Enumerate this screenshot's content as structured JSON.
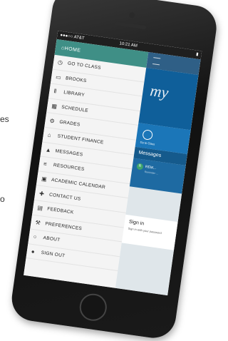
{
  "background_text": [
    "es",
    "o"
  ],
  "status_bar": {
    "carrier": "●●●○○ AT&T",
    "time": "10:21 AM"
  },
  "menu": {
    "home_label": "HOME",
    "items": [
      {
        "icon": "clock-icon",
        "glyph": "◷",
        "label": "GO TO CLASS"
      },
      {
        "icon": "book-icon",
        "glyph": "▭",
        "label": "BROOKS"
      },
      {
        "icon": "library-icon",
        "glyph": "Ⅱ",
        "label": "LIBRARY"
      },
      {
        "icon": "calendar-icon",
        "glyph": "▦",
        "label": "SCHEDULE"
      },
      {
        "icon": "grades-icon",
        "glyph": "⚙",
        "label": "GRADES"
      },
      {
        "icon": "bank-icon",
        "glyph": "⌂",
        "label": "STUDENT FINANCE"
      },
      {
        "icon": "messages-icon",
        "glyph": "▲",
        "label": "MESSAGES"
      },
      {
        "icon": "resources-icon",
        "glyph": "≡",
        "label": "RESOURCES"
      },
      {
        "icon": "academic-calendar-icon",
        "glyph": "▣",
        "label": "ACADEMIC CALENDAR"
      },
      {
        "icon": "contact-icon",
        "glyph": "✚",
        "label": "CONTACT US"
      },
      {
        "icon": "feedback-icon",
        "glyph": "▤",
        "label": "FEEDBACK"
      },
      {
        "icon": "preferences-icon",
        "glyph": "⚒",
        "label": "PREFERENCES"
      },
      {
        "icon": "about-icon",
        "glyph": "○",
        "label": "ABOUT"
      },
      {
        "icon": "signout-icon",
        "glyph": "●",
        "label": "SIGN OUT"
      }
    ]
  },
  "content": {
    "banner_text": "my",
    "tile_label": "Go to Class",
    "messages_heading": "Messages",
    "message_badge": "R",
    "message_title": "REM...",
    "message_sub": "Reminder ...",
    "signin_title": "Sign in",
    "signin_sub": "Sign in with your password"
  }
}
